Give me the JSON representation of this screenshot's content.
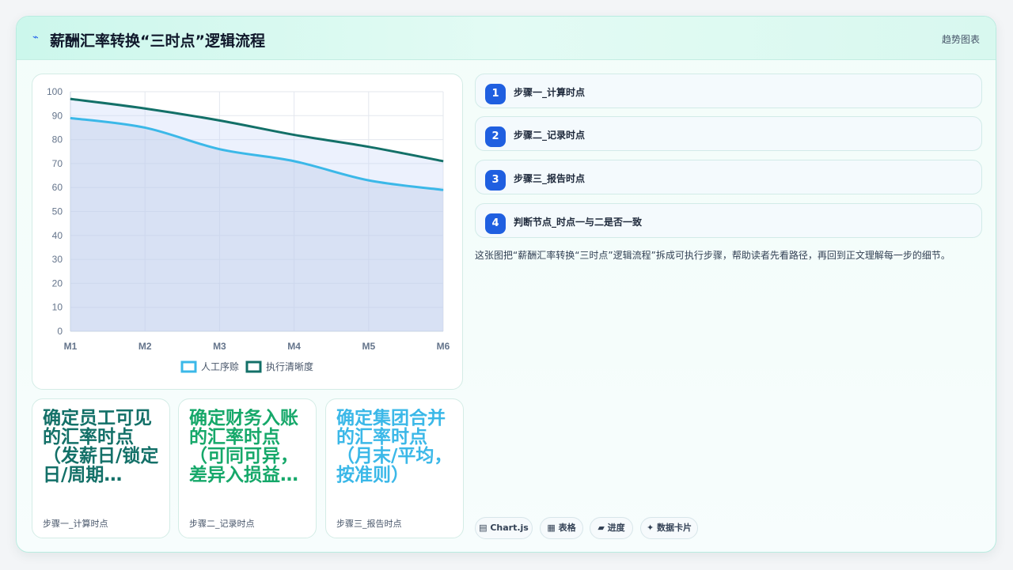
{
  "header": {
    "icon": "spark-icon",
    "title": "薪酬汇率转换“三时点”逻辑流程",
    "tag": "趋势图表"
  },
  "chart_data": {
    "type": "area",
    "x": [
      "M1",
      "M2",
      "M3",
      "M4",
      "M5",
      "M6"
    ],
    "ylim": [
      0,
      100
    ],
    "yticks": [
      0,
      10,
      20,
      30,
      40,
      50,
      60,
      70,
      80,
      90,
      100
    ],
    "grid": true,
    "legend_position": "bottom",
    "series": [
      {
        "name": "人工序赊",
        "values": [
          89,
          85,
          76,
          71,
          63,
          59
        ],
        "color": "#3bb8e8",
        "fill": true
      },
      {
        "name": "执行清晰度",
        "values": [
          97,
          93,
          88,
          82,
          77,
          71
        ],
        "color": "#137068",
        "fill": true
      }
    ]
  },
  "kpis": [
    {
      "big": "确定员工可见的汇率时点（发薪日/锁定日/周期…",
      "sub": "步骤一_计算时点",
      "color": "#137068"
    },
    {
      "big": "确定财务入账的汇率时点（可同可异，差异入损益…",
      "sub": "步骤二_记录时点",
      "color": "#16a86a"
    },
    {
      "big": "确定集团合并的汇率时点（月末/平均，按准则）",
      "sub": "步骤三_报告时点",
      "color": "#3bb8e8"
    }
  ],
  "steps": [
    {
      "num": "1",
      "label": "步骤一_计算时点"
    },
    {
      "num": "2",
      "label": "步骤二_记录时点"
    },
    {
      "num": "3",
      "label": "步骤三_报告时点"
    },
    {
      "num": "4",
      "label": "判断节点_时点一与二是否一致"
    }
  ],
  "description": "这张图把“薪酬汇率转换“三时点”逻辑流程”拆成可执行步骤，帮助读者先看路径，再回到正文理解每一步的细节。",
  "pills": [
    "▤ Chart.js",
    "▦ 表格",
    "▰ 进度",
    "✦ 数据卡片"
  ]
}
